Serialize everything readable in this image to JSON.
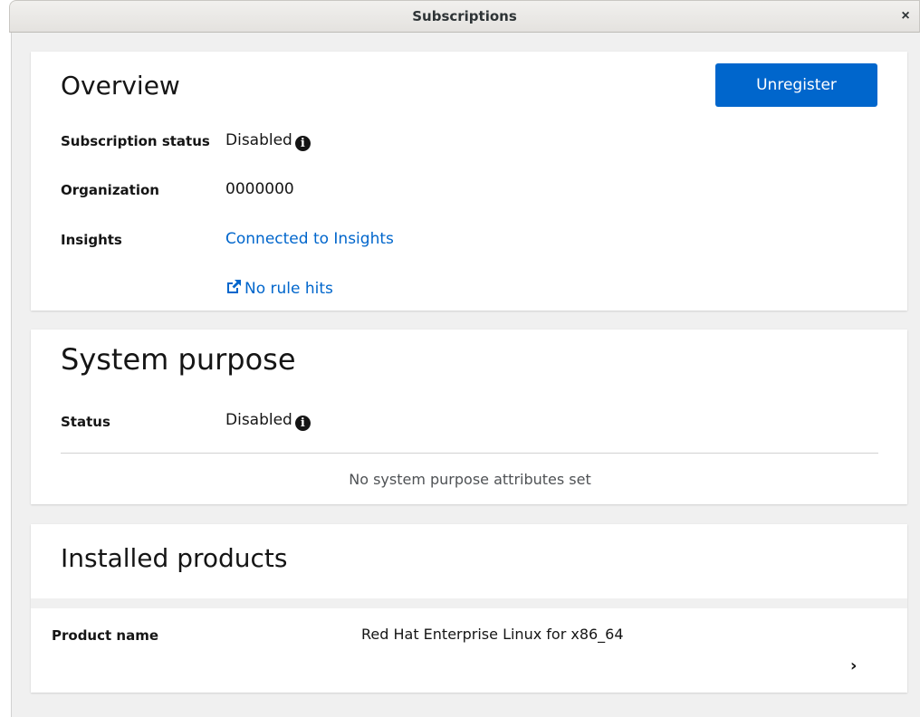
{
  "window": {
    "title": "Subscriptions",
    "close_glyph": "×"
  },
  "overview": {
    "title": "Overview",
    "unregister_label": "Unregister",
    "subscription_status_label": "Subscription status",
    "subscription_status_value": "Disabled",
    "organization_label": "Organization",
    "organization_value": "0000000",
    "insights_label": "Insights",
    "insights_value": "Connected to Insights",
    "rule_hits_link": "No rule hits"
  },
  "system_purpose": {
    "title": "System purpose",
    "status_label": "Status",
    "status_value": "Disabled",
    "empty_message": "No system purpose attributes set"
  },
  "installed_products": {
    "title": "Installed products",
    "product_name_label": "Product name",
    "product_name_value": "Red Hat Enterprise Linux for x86_64",
    "expand_glyph": "›"
  },
  "icons": {
    "info": "info-circle-icon",
    "external": "external-link-icon",
    "close": "close-icon",
    "chevron": "chevron-right-icon"
  },
  "colors": {
    "primary": "#0066cc",
    "background": "#f0f0f0",
    "card": "#ffffff",
    "text": "#151515"
  }
}
